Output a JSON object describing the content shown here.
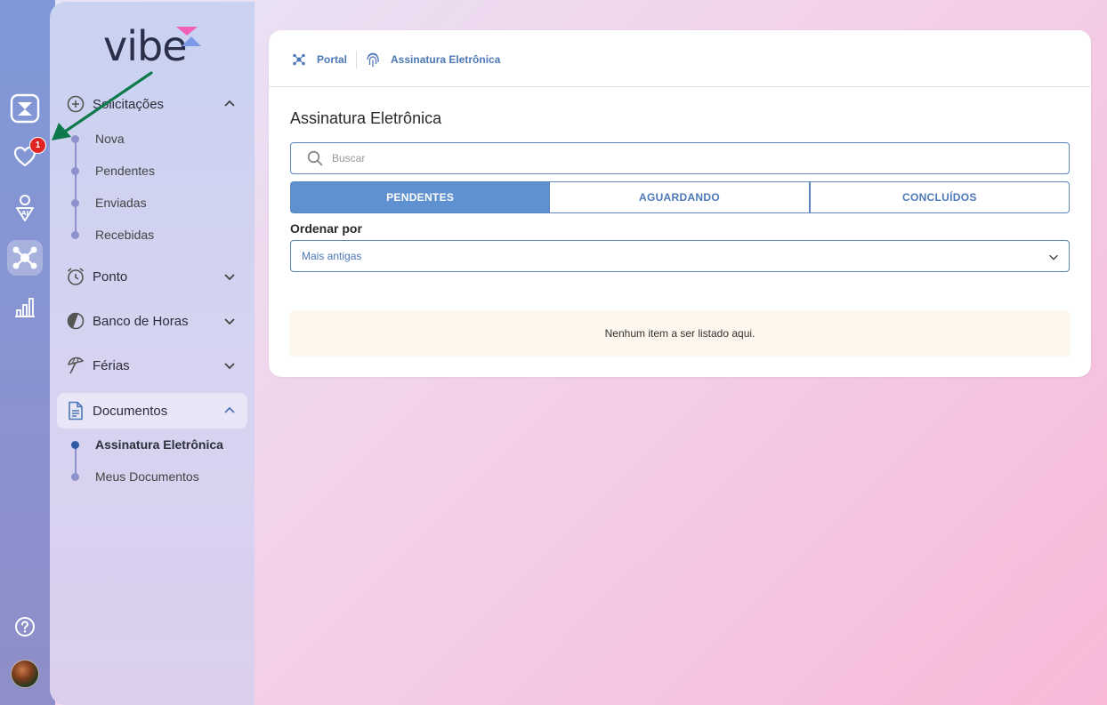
{
  "rail": {
    "notification_count": "1",
    "icons": [
      "vibe-app-icon",
      "heart-icon",
      "ai-person-icon",
      "portal-network-icon",
      "bar-chart-icon",
      "help-icon"
    ]
  },
  "brand": {
    "logo_text": "vibe"
  },
  "sidebar": {
    "groups": [
      {
        "label": "Solicitações",
        "expanded": true,
        "items": [
          "Nova",
          "Pendentes",
          "Enviadas",
          "Recebidas"
        ]
      },
      {
        "label": "Ponto",
        "expanded": false
      },
      {
        "label": "Banco de Horas",
        "expanded": false
      },
      {
        "label": "Férias",
        "expanded": false
      },
      {
        "label": "Documentos",
        "expanded": true,
        "items": [
          "Assinatura Eletrônica",
          "Meus Documentos"
        ],
        "active_item": "Assinatura Eletrônica"
      }
    ]
  },
  "breadcrumb": {
    "portal": "Portal",
    "current": "Assinatura Eletrônica"
  },
  "main": {
    "title": "Assinatura Eletrônica",
    "search_placeholder": "Buscar",
    "tabs": [
      {
        "label": "PENDENTES",
        "active": true
      },
      {
        "label": "AGUARDANDO",
        "active": false
      },
      {
        "label": "CONCLUÍDOS",
        "active": false
      }
    ],
    "sort_label": "Ordenar por",
    "sort_value": "Mais antigas",
    "empty_message": "Nenhum item a ser listado aqui."
  },
  "colors": {
    "accent": "#5f91d0",
    "accent_text": "#4d78b8",
    "badge": "#e02424",
    "arrow": "#0e7a4b",
    "empty_bg": "#fdf6ec"
  }
}
